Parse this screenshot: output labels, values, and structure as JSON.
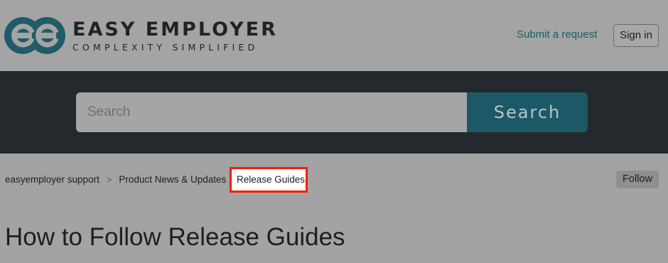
{
  "header": {
    "brand_name": "EASY EMPLOYER",
    "brand_tagline": "COMPLEXITY SIMPLIFIED",
    "submit_request": "Submit a request",
    "sign_in": "Sign in"
  },
  "search": {
    "placeholder": "Search",
    "button_label": "Search"
  },
  "breadcrumb": {
    "items": [
      "easyemployer support",
      "Product News & Updates",
      "Release Guides"
    ],
    "separator": ">"
  },
  "follow_label": "Follow",
  "page_title": "How to Follow Release Guides",
  "colors": {
    "brand_teal": "#1c5966",
    "highlight": "#ff1a00",
    "header_bg": "#a4a4a4",
    "search_band_bg": "#23292d"
  },
  "icons": {
    "logo": "ee-logo-mark"
  }
}
